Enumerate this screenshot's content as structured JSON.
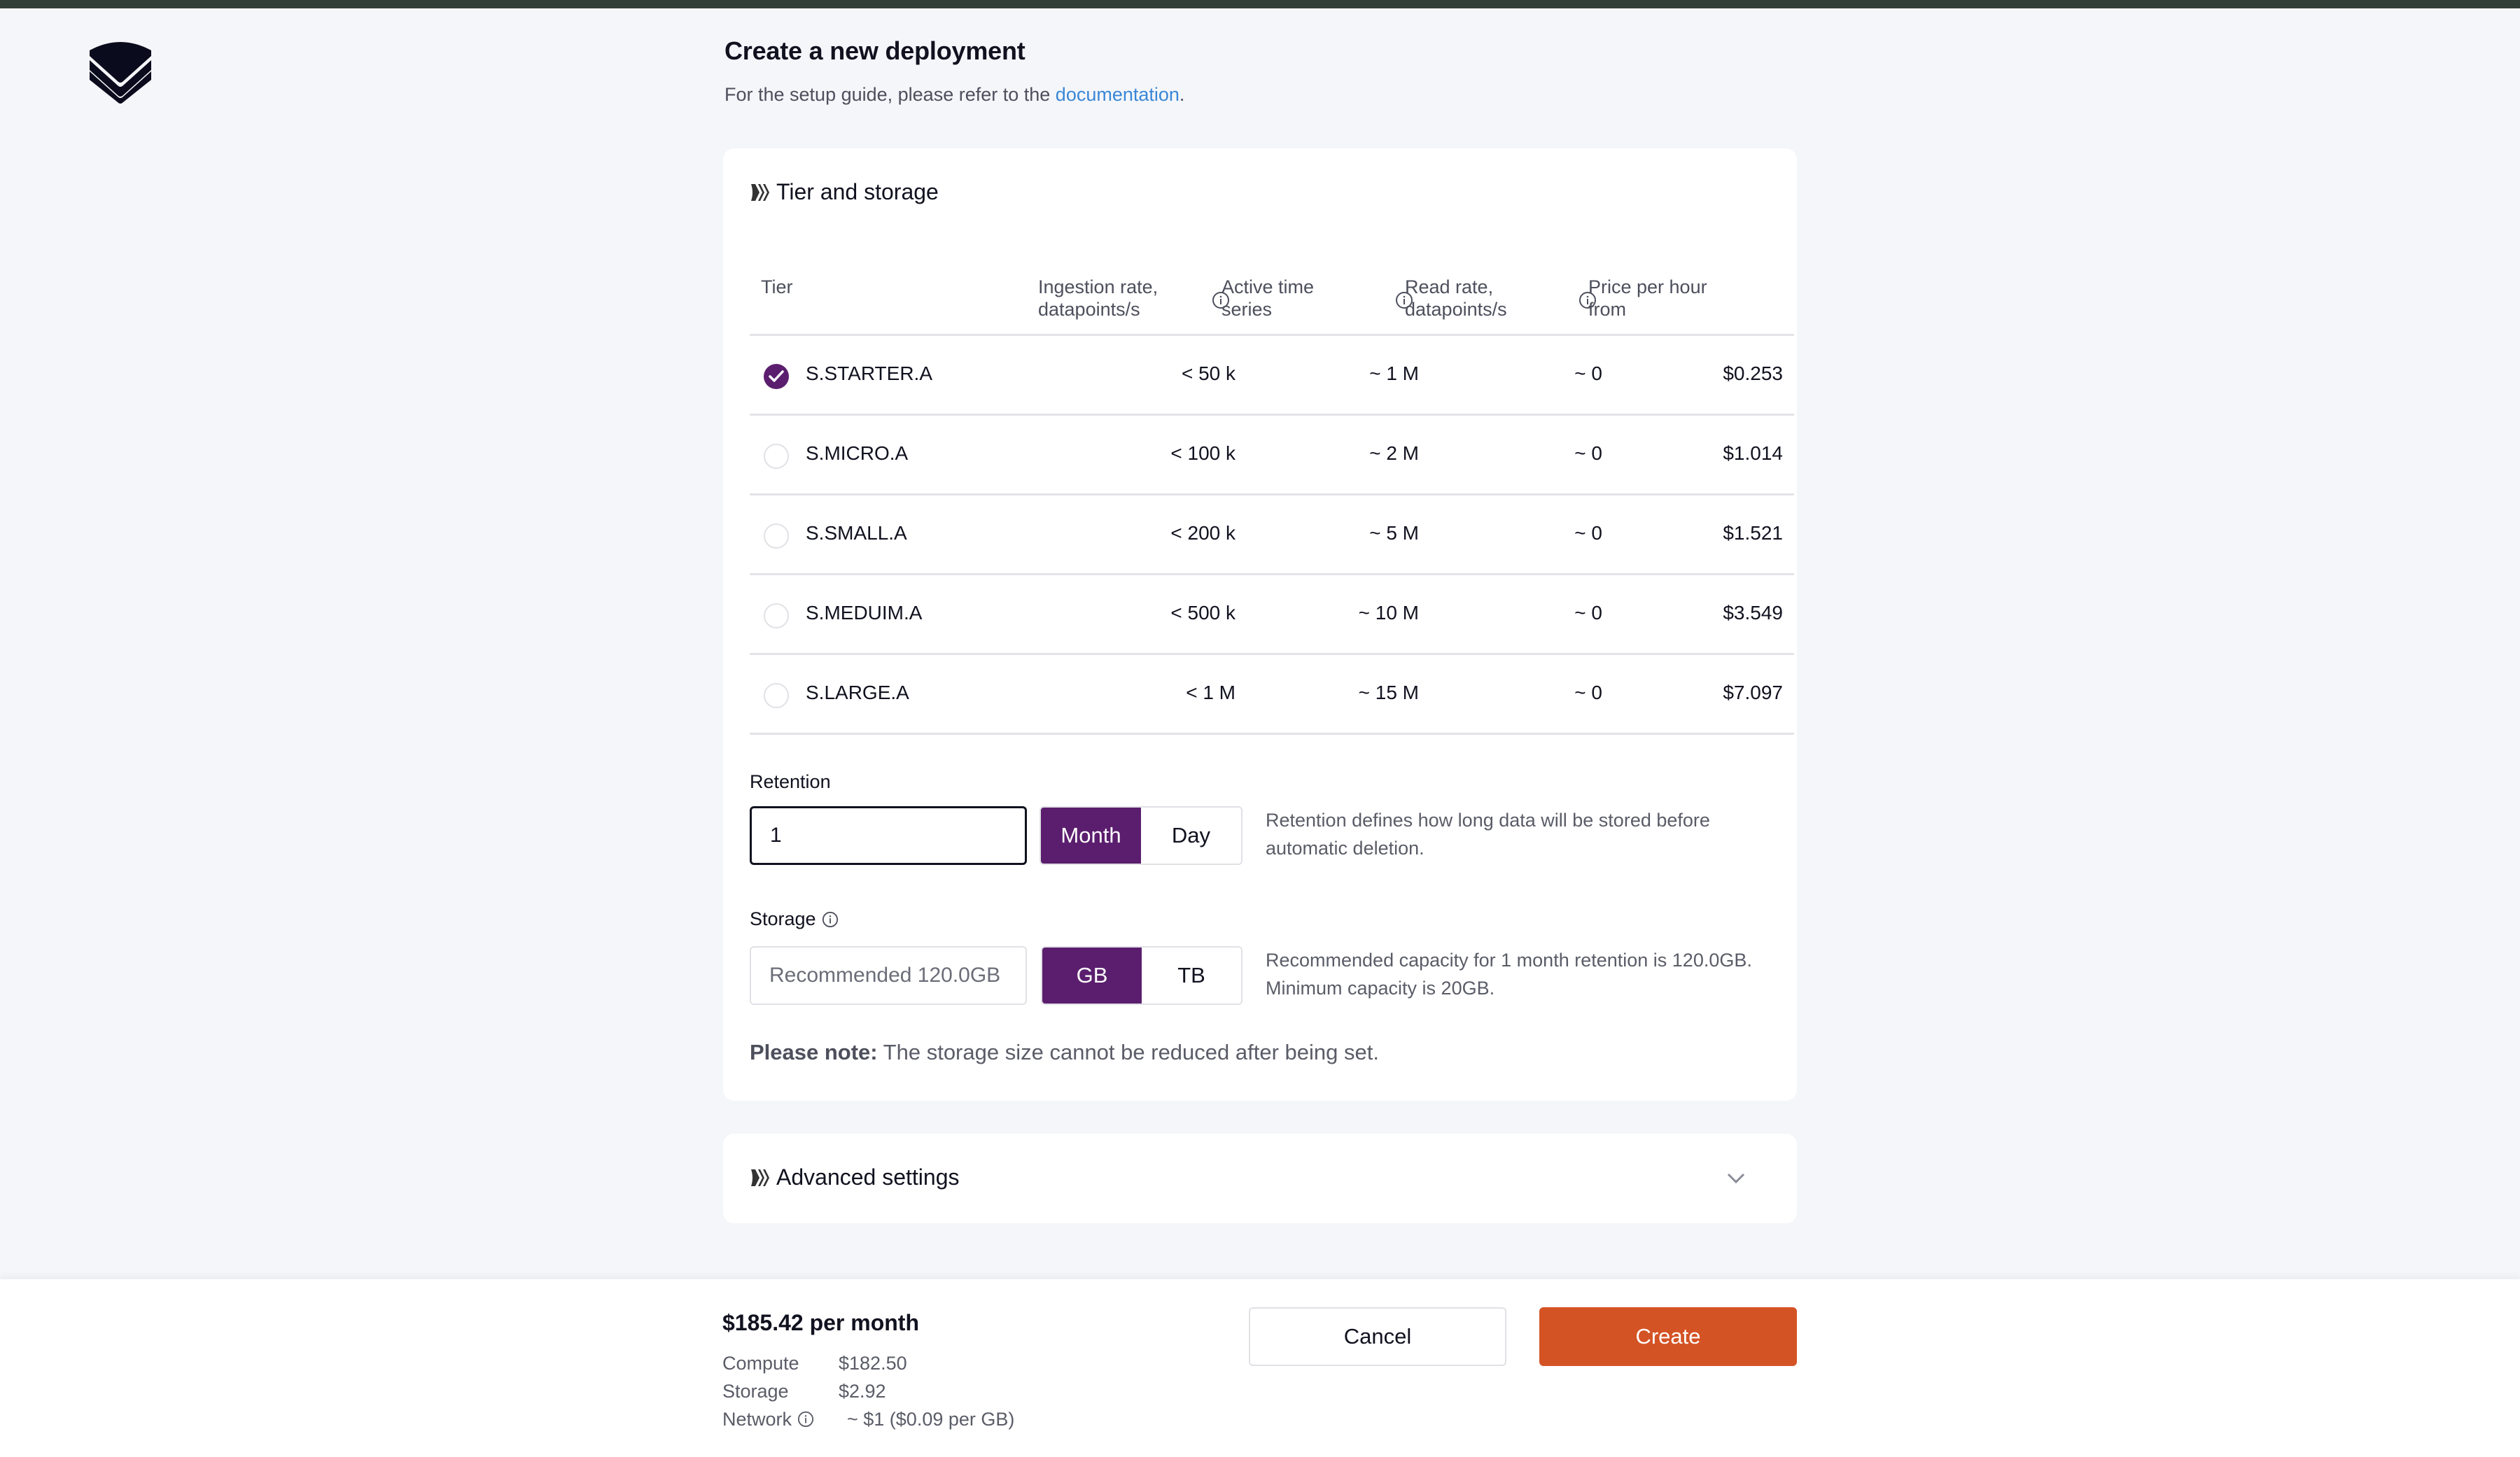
{
  "header": {
    "logo": "layered-chevron-logo",
    "title": "Create a new deployment",
    "subtitle_prefix": "For the setup guide, please refer to the ",
    "subtitle_link": "documentation",
    "subtitle_suffix": "."
  },
  "tier_section": {
    "title": "Tier and storage",
    "icon": "chevrons-right-icon",
    "columns": [
      {
        "key": "tier",
        "label_line1": "Tier",
        "label_line2": ""
      },
      {
        "key": "ingestion",
        "label_line1": "Ingestion rate,",
        "label_line2": "datapoints/s",
        "info": true
      },
      {
        "key": "active",
        "label_line1": "Active time",
        "label_line2": "series",
        "info": true
      },
      {
        "key": "read",
        "label_line1": "Read rate,",
        "label_line2": "datapoints/s",
        "info": true
      },
      {
        "key": "price",
        "label_line1": "Price per hour",
        "label_line2": "from"
      }
    ],
    "rows": [
      {
        "tier": "S.STARTER.A",
        "ingestion": "< 50 k",
        "active": "~ 1 M",
        "read": "~ 0",
        "price": "$0.253",
        "selected": true
      },
      {
        "tier": "S.MICRO.A",
        "ingestion": "< 100 k",
        "active": "~ 2 M",
        "read": "~ 0",
        "price": "$1.014",
        "selected": false
      },
      {
        "tier": "S.SMALL.A",
        "ingestion": "< 200 k",
        "active": "~ 5 M",
        "read": "~ 0",
        "price": "$1.521",
        "selected": false
      },
      {
        "tier": "S.MEDUIM.A",
        "ingestion": "< 500 k",
        "active": "~ 10 M",
        "read": "~ 0",
        "price": "$3.549",
        "selected": false
      },
      {
        "tier": "S.LARGE.A",
        "ingestion": "< 1 M",
        "active": "~ 15 M",
        "read": "~ 0",
        "price": "$7.097",
        "selected": false
      }
    ],
    "retention": {
      "label": "Retention",
      "value": "1",
      "units": [
        "Month",
        "Day"
      ],
      "selected_unit": "Month",
      "help": "Retention defines how long data will be stored before automatic deletion."
    },
    "storage": {
      "label": "Storage",
      "placeholder": "Recommended 120.0GB",
      "units": [
        "GB",
        "TB"
      ],
      "selected_unit": "GB",
      "help_line1": "Recommended capacity for 1 month retention is 120.0GB.",
      "help_line2": "Minimum capacity is 20GB."
    },
    "note_bold": "Please note:",
    "note_text": " The storage size cannot be reduced after being set."
  },
  "advanced_section": {
    "title": "Advanced settings",
    "expanded": false
  },
  "footer": {
    "total": "$185.42 per month",
    "breakdown": [
      {
        "label": "Compute",
        "value": "$182.50",
        "info": false
      },
      {
        "label": "Storage",
        "value": "$2.92",
        "info": false
      },
      {
        "label": "Network",
        "value": "~ $1 ($0.09 per GB)",
        "info": true
      }
    ],
    "cancel_label": "Cancel",
    "create_label": "Create"
  },
  "colors": {
    "accent_purple": "#5b1e6e",
    "create_orange": "#d45325",
    "link_blue": "#3a87d6",
    "topbar": "#323f38"
  }
}
